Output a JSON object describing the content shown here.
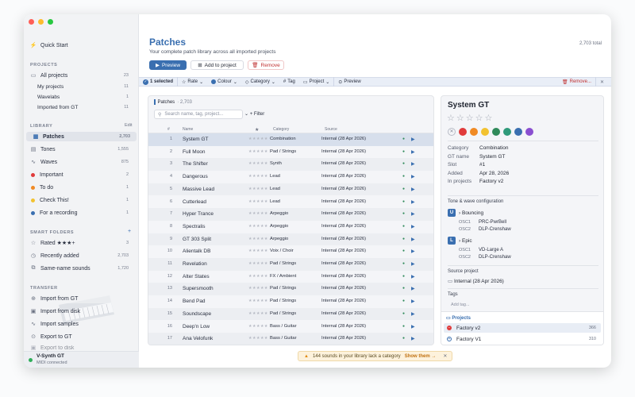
{
  "sidebar": {
    "quick_start": "Quick Start",
    "projects_head": "PROJECTS",
    "all_projects": "All projects",
    "all_projects_count": "23",
    "projects": [
      {
        "label": "My projects",
        "count": "11"
      },
      {
        "label": "Wavelabs",
        "count": "1"
      },
      {
        "label": "Imported from GT",
        "count": "11"
      }
    ],
    "library_head": "LIBRARY",
    "library_edit": "Edit",
    "library": [
      {
        "label": "Patches",
        "count": "2,703",
        "icon": "grid-icon"
      },
      {
        "label": "Tones",
        "count": "1,555",
        "icon": "tones-icon"
      },
      {
        "label": "Waves",
        "count": "875",
        "icon": "wave-icon"
      },
      {
        "label": "Important",
        "count": "2",
        "color": "#e03b3b"
      },
      {
        "label": "To do",
        "count": "1",
        "color": "#f08a24"
      },
      {
        "label": "Check This!",
        "count": "1",
        "color": "#f2c230"
      },
      {
        "label": "For a recording",
        "count": "1",
        "color": "#3a6fb0"
      }
    ],
    "smart_head": "SMART FOLDERS",
    "smart_add": "+",
    "smart": [
      {
        "label": "Rated ★★★+",
        "count": "3"
      },
      {
        "label": "Recently added",
        "count": "2,703"
      },
      {
        "label": "Same-name sounds",
        "count": "1,720"
      }
    ],
    "transfer_head": "TRANSFER",
    "transfer": [
      {
        "label": "Import from GT"
      },
      {
        "label": "Import from disk"
      },
      {
        "label": "Import samples"
      },
      {
        "label": "Export to GT"
      },
      {
        "label": "Export to disk"
      }
    ],
    "device_name": "V-Synth GT",
    "device_status": "MIDI connected"
  },
  "main": {
    "title": "Patches",
    "subtitle": "Your complete patch library across all imported projects",
    "total": "2,703 total",
    "preview_btn": "Preview",
    "add_btn": "Add to project",
    "remove_btn": "Remove"
  },
  "toolbar": {
    "selected": "1 selected",
    "rate": "Rate",
    "colour": "Colour",
    "category": "Category",
    "tag": "Tag",
    "project": "Project",
    "preview": "Preview",
    "remove": "Remove..."
  },
  "list": {
    "title": "Patches",
    "count": "· 2,703",
    "search_placeholder": "Search name, tag, project...",
    "filter": "+ Filter",
    "cols": {
      "num": "#",
      "name": "Name",
      "star": "★",
      "category": "Category",
      "source": "Source"
    },
    "rows": [
      {
        "n": "1",
        "name": "System GT",
        "cat": "Combination",
        "src": "Internal (28 Apr 2026)"
      },
      {
        "n": "2",
        "name": "Full Moon",
        "cat": "Pad / Strings",
        "src": "Internal (28 Apr 2026)"
      },
      {
        "n": "3",
        "name": "The Shifter",
        "cat": "Synth",
        "src": "Internal (28 Apr 2026)"
      },
      {
        "n": "4",
        "name": "Dangerous",
        "cat": "Lead",
        "src": "Internal (28 Apr 2026)"
      },
      {
        "n": "5",
        "name": "Massive Lead",
        "cat": "Lead",
        "src": "Internal (28 Apr 2026)"
      },
      {
        "n": "6",
        "name": "Cutterlead",
        "cat": "Lead",
        "src": "Internal (28 Apr 2026)"
      },
      {
        "n": "7",
        "name": "Hyper Trance",
        "cat": "Arpeggio",
        "src": "Internal (28 Apr 2026)"
      },
      {
        "n": "8",
        "name": "Spectralis",
        "cat": "Arpeggio",
        "src": "Internal (28 Apr 2026)"
      },
      {
        "n": "9",
        "name": "GT 303 Split",
        "cat": "Arpeggio",
        "src": "Internal (28 Apr 2026)"
      },
      {
        "n": "10",
        "name": "Alientalk DB",
        "cat": "Voix / Choir",
        "src": "Internal (28 Apr 2026)"
      },
      {
        "n": "11",
        "name": "Revelation",
        "cat": "Pad / Strings",
        "src": "Internal (28 Apr 2026)"
      },
      {
        "n": "12",
        "name": "Alter States",
        "cat": "FX / Ambient",
        "src": "Internal (28 Apr 2026)"
      },
      {
        "n": "13",
        "name": "Supersmooth",
        "cat": "Pad / Strings",
        "src": "Internal (28 Apr 2026)"
      },
      {
        "n": "14",
        "name": "Bend Pad",
        "cat": "Pad / Strings",
        "src": "Internal (28 Apr 2026)"
      },
      {
        "n": "15",
        "name": "Soundscape",
        "cat": "Pad / Strings",
        "src": "Internal (28 Apr 2026)"
      },
      {
        "n": "16",
        "name": "Deep'n Low",
        "cat": "Bass / Guitar",
        "src": "Internal (28 Apr 2026)"
      },
      {
        "n": "17",
        "name": "Ana Velofunk",
        "cat": "Bass / Guitar",
        "src": "Internal (28 Apr 2026)"
      }
    ]
  },
  "detail": {
    "name": "System GT",
    "colors": [
      "#e03b3b",
      "#f08a24",
      "#f2c230",
      "#2f8a5a",
      "#2f9a7a",
      "#3a6fb0",
      "#8a4fd0"
    ],
    "props": [
      {
        "k": "Category",
        "v": "Combination"
      },
      {
        "k": "GT name",
        "v": "System GT"
      },
      {
        "k": "Slot",
        "v": "#1"
      },
      {
        "k": "Added",
        "v": "Apr 28, 2026"
      },
      {
        "k": "In projects",
        "v": "Factory v2"
      }
    ],
    "tone_head": "Tone & wave configuration",
    "tones": [
      {
        "badge": "U",
        "name": "Bouncing",
        "osc1_label": "OSC1",
        "osc1": "PRC-PwrBell",
        "osc2_label": "OSC2",
        "osc2": "DLP-Crenshaw"
      },
      {
        "badge": "L",
        "name": "Epic",
        "osc1_label": "OSC1",
        "osc1": "VD-Large A",
        "osc2_label": "OSC2",
        "osc2": "DLP-Crenshaw"
      }
    ],
    "source_head": "Source project",
    "source": "Internal (28 Apr 2026)",
    "tags_head": "Tags",
    "add_tag": "Add tag...",
    "projects_head": "Projects",
    "projects": [
      {
        "label": "Factory v2",
        "count": "366"
      },
      {
        "label": "Factory V1",
        "count": "310"
      }
    ]
  },
  "banner": {
    "text": "144 sounds in your library lack a category",
    "action": "Show them →",
    "close": "✕"
  }
}
